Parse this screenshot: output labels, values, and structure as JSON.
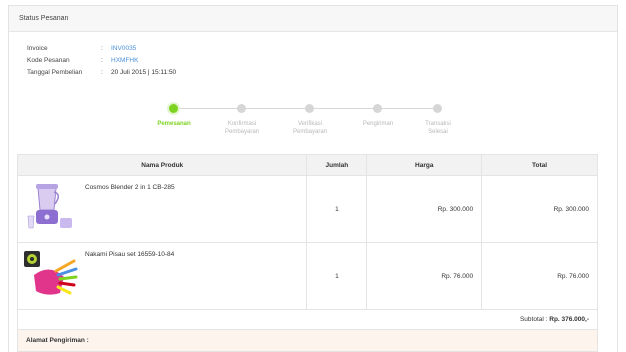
{
  "panel": {
    "title": "Status Pesanan"
  },
  "order_info": [
    {
      "label": "Invoice",
      "colon": ":",
      "value": "INV0035",
      "link": true
    },
    {
      "label": "Kode Pesanan",
      "colon": ":",
      "value": "HXMFHK",
      "link": true
    },
    {
      "label": "Tanggal Pembelian",
      "colon": ":",
      "value": "20 Juli 2015 | 15:11:50",
      "link": false
    }
  ],
  "steps": [
    {
      "lines": [
        "Pemesanan"
      ],
      "active": true
    },
    {
      "lines": [
        "Konfirmasi",
        "Pembayaran"
      ],
      "active": false
    },
    {
      "lines": [
        "Verifikasi",
        "Pembayaran"
      ],
      "active": false
    },
    {
      "lines": [
        "Pengiriman"
      ],
      "active": false
    },
    {
      "lines": [
        "Transaksi",
        "Selesai"
      ],
      "active": false
    }
  ],
  "table": {
    "headers": {
      "product": "Nama Produk",
      "qty": "Jumlah",
      "price": "Harga",
      "total": "Total"
    },
    "rows": [
      {
        "name": "Cosmos Blender 2 in 1 CB-285",
        "qty": "1",
        "price": "Rp. 300.000",
        "total": "Rp. 300.000",
        "image": "blender-image"
      },
      {
        "name": "Nakami Pisau set 16559-10-84",
        "qty": "1",
        "price": "Rp. 76.000",
        "total": "Rp. 76.000",
        "image": "knife-set-image"
      }
    ],
    "subtotal_label": "Subtotal :",
    "subtotal_value": "Rp. 376.000,-"
  },
  "shipping": {
    "label": "Alamat Pengiriman :"
  }
}
